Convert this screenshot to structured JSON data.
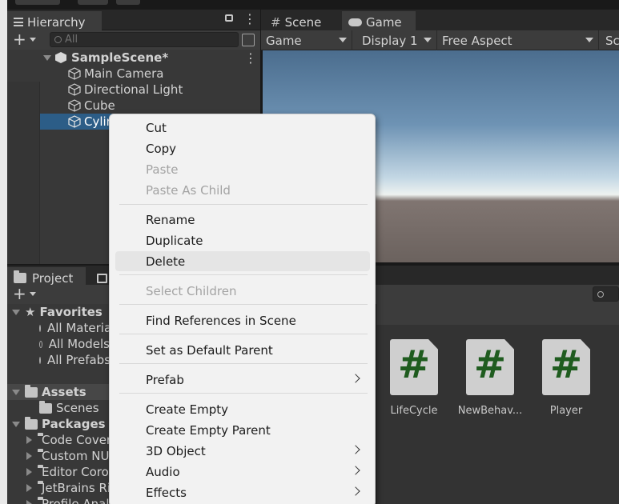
{
  "hierarchy": {
    "tab_label": "Hierarchy",
    "search_placeholder": "All",
    "scene_name": "SampleScene*",
    "items": [
      {
        "label": "Main Camera"
      },
      {
        "label": "Directional Light"
      },
      {
        "label": "Cube"
      },
      {
        "label": "Cylinder"
      }
    ]
  },
  "game": {
    "tabs": [
      {
        "label": "Scene"
      },
      {
        "label": "Game"
      }
    ],
    "toolbar": {
      "view_mode": "Game",
      "display": "Display 1",
      "aspect": "Free Aspect",
      "scale_partial": "Sc"
    }
  },
  "project": {
    "tab_label": "Project",
    "favorites_label": "Favorites",
    "favorites": [
      {
        "label": "All Materials"
      },
      {
        "label": "All Models"
      },
      {
        "label": "All Prefabs"
      }
    ],
    "assets_label": "Assets",
    "assets_children": [
      {
        "label": "Scenes"
      }
    ],
    "packages_label": "Packages",
    "packages": [
      {
        "label": "Code Coverage"
      },
      {
        "label": "Custom NUnit"
      },
      {
        "label": "Editor Coroutines"
      },
      {
        "label": "JetBrains Rider Editor"
      },
      {
        "label": "Profile Analyzer"
      }
    ],
    "assets": [
      {
        "label": "LifeCycle"
      },
      {
        "label": "NewBehav..."
      },
      {
        "label": "Player"
      }
    ]
  },
  "context_menu": {
    "groups": [
      [
        {
          "label": "Cut",
          "disabled": false
        },
        {
          "label": "Copy",
          "disabled": false
        },
        {
          "label": "Paste",
          "disabled": true
        },
        {
          "label": "Paste As Child",
          "disabled": true
        }
      ],
      [
        {
          "label": "Rename",
          "disabled": false
        },
        {
          "label": "Duplicate",
          "disabled": false
        },
        {
          "label": "Delete",
          "disabled": false,
          "hover": true
        }
      ],
      [
        {
          "label": "Select Children",
          "disabled": true
        }
      ],
      [
        {
          "label": "Find References in Scene",
          "disabled": false
        }
      ],
      [
        {
          "label": "Set as Default Parent",
          "disabled": false
        }
      ],
      [
        {
          "label": "Prefab",
          "disabled": false,
          "submenu": true
        }
      ],
      [
        {
          "label": "Create Empty",
          "disabled": false
        },
        {
          "label": "Create Empty Parent",
          "disabled": false
        },
        {
          "label": "3D Object",
          "disabled": false,
          "submenu": true
        },
        {
          "label": "Audio",
          "disabled": false,
          "submenu": true
        },
        {
          "label": "Effects",
          "disabled": false,
          "submenu": true
        }
      ]
    ]
  },
  "colors": {
    "selection": "#2c5d87",
    "script_hash": "#1f5c1f",
    "menu_bg": "#f2f2f2"
  }
}
